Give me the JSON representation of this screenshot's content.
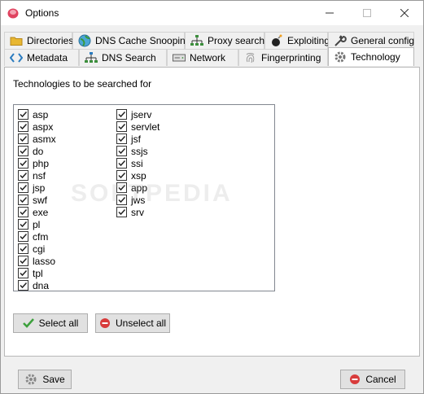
{
  "window": {
    "title": "Options"
  },
  "tabs_row1": [
    {
      "label": "Directories",
      "icon": "folder-icon"
    },
    {
      "label": "DNS Cache Snooping",
      "icon": "globe-icon"
    },
    {
      "label": "Proxy search",
      "icon": "network-icon"
    },
    {
      "label": "Exploiting",
      "icon": "bomb-icon"
    },
    {
      "label": "General config",
      "icon": "wrench-icon"
    }
  ],
  "tabs_row2": [
    {
      "label": "Metadata",
      "icon": "code-icon"
    },
    {
      "label": "DNS Search",
      "icon": "network-icon"
    },
    {
      "label": "Network",
      "icon": "server-icon"
    },
    {
      "label": "Fingerprinting",
      "icon": "fingerprint-icon"
    },
    {
      "label": "Technology",
      "icon": "gear-icon",
      "active": true
    }
  ],
  "panel": {
    "label": "Technologies to be searched for",
    "technologies_col1": [
      "asp",
      "aspx",
      "asmx",
      "do",
      "php",
      "nsf",
      "jsp",
      "swf",
      "exe",
      "pl",
      "cfm",
      "cgi",
      "lasso",
      "tpl",
      "dna"
    ],
    "technologies_col2": [
      "jserv",
      "servlet",
      "jsf",
      "ssjs",
      "ssi",
      "xsp",
      "app",
      "jws",
      "srv"
    ],
    "all_checked": true,
    "select_all_label": "Select all",
    "unselect_all_label": "Unselect all"
  },
  "footer": {
    "save_label": "Save",
    "cancel_label": "Cancel"
  },
  "watermark": "SOFTPEDIA",
  "colors": {
    "accent_green": "#3ca03c",
    "cancel_red": "#d83b3b",
    "tab_active_bg": "#ffffff"
  }
}
